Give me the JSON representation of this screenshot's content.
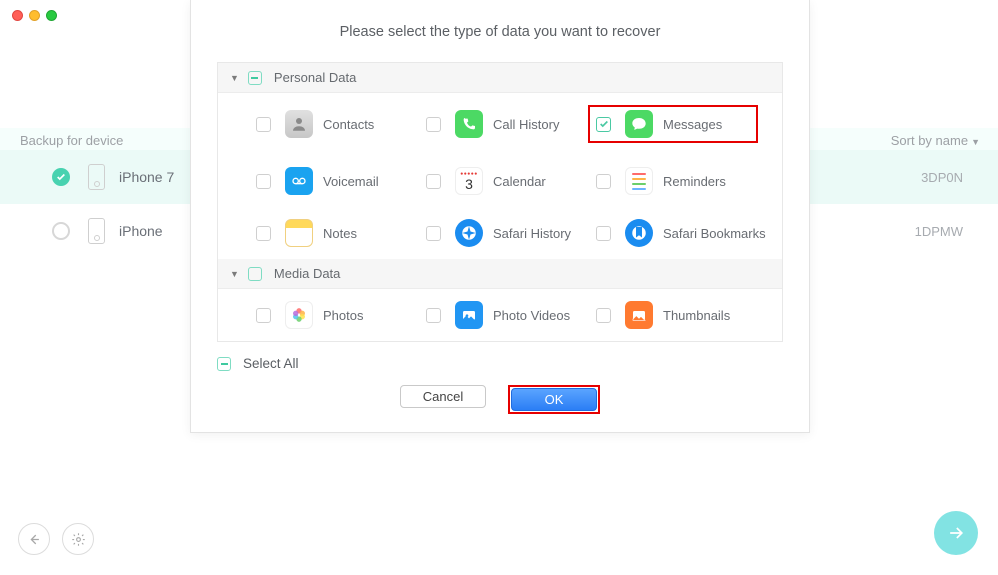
{
  "traffic_lights": [
    "close",
    "min",
    "zoom"
  ],
  "background": {
    "left_label": "Backup for device",
    "sort_label": "Sort by name",
    "devices": [
      {
        "name": "iPhone 7",
        "serial_tail": "3DP0N",
        "selected": true
      },
      {
        "name": "iPhone",
        "serial_tail": "1DPMW",
        "selected": false
      }
    ]
  },
  "modal": {
    "title": "Please select the type of data you want to recover",
    "sections": [
      {
        "title": "Personal Data",
        "rows": [
          [
            {
              "key": "contacts",
              "label": "Contacts",
              "checked": false
            },
            {
              "key": "callhistory",
              "label": "Call History",
              "checked": false
            },
            {
              "key": "messages",
              "label": "Messages",
              "checked": true,
              "highlight": true
            }
          ],
          [
            {
              "key": "voicemail",
              "label": "Voicemail",
              "checked": false
            },
            {
              "key": "calendar",
              "label": "Calendar",
              "checked": false
            },
            {
              "key": "reminders",
              "label": "Reminders",
              "checked": false
            }
          ],
          [
            {
              "key": "notes",
              "label": "Notes",
              "checked": false
            },
            {
              "key": "safarihistory",
              "label": "Safari History",
              "checked": false
            },
            {
              "key": "safaribookmarks",
              "label": "Safari Bookmarks",
              "checked": false
            }
          ]
        ]
      },
      {
        "title": "Media Data",
        "rows": [
          [
            {
              "key": "photos",
              "label": "Photos",
              "checked": false
            },
            {
              "key": "photovideos",
              "label": "Photo Videos",
              "checked": false
            },
            {
              "key": "thumbnails",
              "label": "Thumbnails",
              "checked": false
            }
          ]
        ]
      }
    ],
    "select_all_label": "Select All",
    "cancel_label": "Cancel",
    "ok_label": "OK",
    "calendar_day": "3"
  }
}
